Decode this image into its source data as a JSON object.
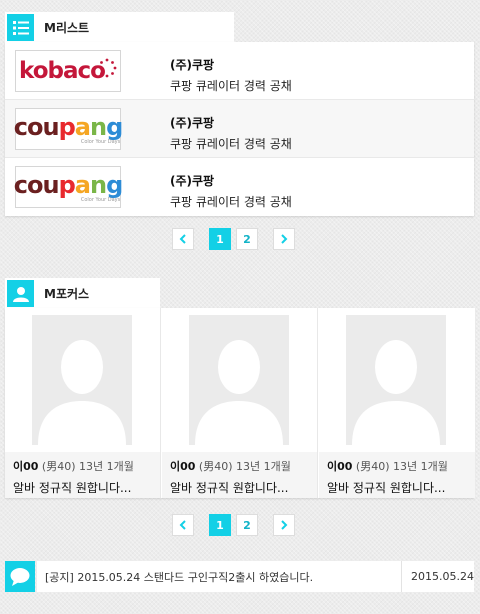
{
  "mlist": {
    "title": "M리스트",
    "icon": "list-icon",
    "items": [
      {
        "logo": "kobaco",
        "company": "(주)쿠팡",
        "job": "쿠팡 큐레이터 경력 공채"
      },
      {
        "logo": "coupang",
        "logo_tagline": "Color Your Days",
        "company": "(주)쿠팡",
        "job": "쿠팡 큐레이터 경력 공채"
      },
      {
        "logo": "coupang",
        "logo_tagline": "Color Your Days",
        "company": "(주)쿠팡",
        "job": "쿠팡 큐레이터 경력 공채"
      }
    ],
    "pagination": {
      "prev": "‹",
      "pages": [
        "1",
        "2"
      ],
      "active": "1",
      "next": "›"
    }
  },
  "mfocus": {
    "title": "M포커스",
    "icon": "user-icon",
    "cards": [
      {
        "name": "이00",
        "detail": " (男40) 13년 1개월",
        "desc": "알바 정규직 원합니다..."
      },
      {
        "name": "이00",
        "detail": " (男40) 13년 1개월",
        "desc": "알바 정규직 원합니다..."
      },
      {
        "name": "이00",
        "detail": " (男40) 13년 1개월",
        "desc": "알바 정규직 원합니다..."
      }
    ],
    "pagination": {
      "prev": "‹",
      "pages": [
        "1",
        "2"
      ],
      "active": "1",
      "next": "›"
    }
  },
  "notice": {
    "icon": "speech-bubble-icon",
    "message": "[공지] 2015.05.24  스탠다드 구인구직2출시 하였습니다.",
    "date": "2015.05.24"
  },
  "colors": {
    "accent": "#13d0e6",
    "kobaco": "#c4173a"
  }
}
